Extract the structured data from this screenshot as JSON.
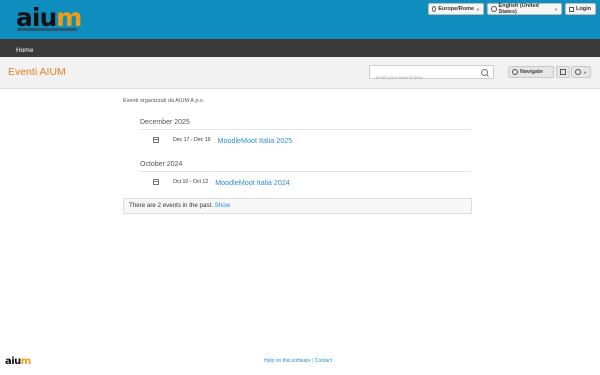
{
  "brand": {
    "logo_text": "aium",
    "logo_tagline": "associazione italiana utenti moodle aps"
  },
  "topbar": {
    "timezone": "Europe/Rome",
    "language": "English (United States)",
    "login": "Login"
  },
  "nav": {
    "home": "Home"
  },
  "page": {
    "title": "Eventi AIUM",
    "search_placeholder": "Enter your search term",
    "navigate": "Navigate"
  },
  "content": {
    "intro": "Eventi organizzati da AIUM A.p.s.",
    "months": [
      {
        "label": "December 2025",
        "event": {
          "date": "Dec 17 - Dec 19",
          "name": "MoodleMoot Italia 2025"
        }
      },
      {
        "label": "October 2024",
        "event": {
          "date": "Oct 10 - Oct 12",
          "name": "MoodleMoot Italia 2024"
        }
      }
    ],
    "past_text": "There are 2 events in the past.",
    "past_link": "Show"
  },
  "footer": {
    "logo_text": "aium",
    "help": "Help on this software",
    "separator": "|",
    "contact": "Contact"
  }
}
